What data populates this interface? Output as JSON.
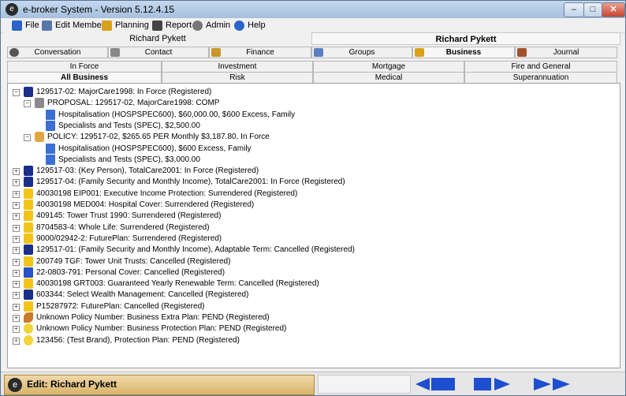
{
  "window": {
    "title": "e-broker System - Version 5.12.4.15",
    "minimize": "–",
    "maximize": "□",
    "close": "✕"
  },
  "menu": [
    {
      "label": "File",
      "icon": "file-icon",
      "color": "#2b64c8"
    },
    {
      "label": "Edit Member",
      "icon": "edit-member-icon",
      "color": "#5577aa"
    },
    {
      "label": "Planning",
      "icon": "planning-icon",
      "color": "#d9a21b"
    },
    {
      "label": "Report",
      "icon": "report-icon",
      "color": "#444444"
    },
    {
      "label": "Admin",
      "icon": "gear-icon",
      "color": "#777777"
    },
    {
      "label": "Help",
      "icon": "help-icon",
      "color": "#2b64c8"
    }
  ],
  "member_headers": {
    "left": "Richard Pykett",
    "right": "Richard Pykett"
  },
  "main_tabs": [
    {
      "label": "Conversation",
      "icon": "conversation-icon",
      "active": false
    },
    {
      "label": "Contact",
      "icon": "contact-icon",
      "active": false
    },
    {
      "label": "Finance",
      "icon": "finance-icon",
      "active": false
    },
    {
      "label": "Groups",
      "icon": "groups-icon",
      "active": false
    },
    {
      "label": "Business",
      "icon": "business-icon",
      "active": true
    },
    {
      "label": "Journal",
      "icon": "journal-icon",
      "active": false
    }
  ],
  "sub_tabs_row1": [
    "In Force",
    "Investment",
    "Mortgage",
    "Fire and General"
  ],
  "sub_tabs_row2": [
    "All Business",
    "Risk",
    "Medical",
    "Superannuation"
  ],
  "tree": [
    {
      "level": 0,
      "expander": "−",
      "icon": "policy-blue",
      "text": "129517-02: MajorCare1998: In Force (Registered)"
    },
    {
      "level": 1,
      "expander": "−",
      "icon": "proposal",
      "text": "PROPOSAL: 129517-02, MajorCare1998: COMP"
    },
    {
      "level": 2,
      "expander": "",
      "icon": "benefit",
      "text": "Hospitalisation (HOSPSPEC600), $60,000.00, $600 Excess, Family"
    },
    {
      "level": 2,
      "expander": "",
      "icon": "benefit",
      "text": "Specialists and Tests (SPEC), $2,500.00"
    },
    {
      "level": 1,
      "expander": "−",
      "icon": "policy-hand",
      "text": "POLICY: 129517-02, $265.65 PER Monthly $3,187.80, In Force"
    },
    {
      "level": 2,
      "expander": "",
      "icon": "benefit",
      "text": "Hospitalisation (HOSPSPEC600), $600 Excess, Family"
    },
    {
      "level": 2,
      "expander": "",
      "icon": "benefit",
      "text": "Specialists and Tests (SPEC), $3,000.00"
    },
    {
      "level": 0,
      "expander": "+",
      "icon": "policy-blue",
      "text": "129517-03: (Key Person), TotalCare2001: In Force (Registered)"
    },
    {
      "level": 0,
      "expander": "+",
      "icon": "policy-blue",
      "text": "129517-04: (Family Security and Monthly Income), TotalCare2001: In Force (Registered)"
    },
    {
      "level": 0,
      "expander": "+",
      "icon": "policy-yellow",
      "text": "40030198 EIP001: Executive Income Protection: Surrendered (Registered)"
    },
    {
      "level": 0,
      "expander": "+",
      "icon": "policy-yellow",
      "text": "40030198 MED004: Hospital Cover: Surrendered (Registered)"
    },
    {
      "level": 0,
      "expander": "+",
      "icon": "policy-yellow",
      "text": "409145: Tower Trust 1990: Surrendered (Registered)"
    },
    {
      "level": 0,
      "expander": "+",
      "icon": "policy-yellow",
      "text": "8704583-4: Whole Life: Surrendered (Registered)"
    },
    {
      "level": 0,
      "expander": "+",
      "icon": "policy-yellow",
      "text": "9000/02942-2: FuturePlan: Surrendered (Registered)"
    },
    {
      "level": 0,
      "expander": "+",
      "icon": "policy-blue",
      "text": "129517-01: (Family Security and Monthly Income), Adaptable Term: Cancelled (Registered)"
    },
    {
      "level": 0,
      "expander": "+",
      "icon": "policy-yellow",
      "text": "200749 TGF: Tower Unit Trusts: Cancelled (Registered)"
    },
    {
      "level": 0,
      "expander": "+",
      "icon": "policy-card",
      "text": "22-0803-791: Personal Cover: Cancelled (Registered)"
    },
    {
      "level": 0,
      "expander": "+",
      "icon": "policy-yellow",
      "text": "40030198 GRT003: Guaranteed Yearly Renewable Term: Cancelled (Registered)"
    },
    {
      "level": 0,
      "expander": "+",
      "icon": "policy-blue",
      "text": "603344: Select Wealth Management: Cancelled (Registered)"
    },
    {
      "level": 0,
      "expander": "+",
      "icon": "policy-yellow",
      "text": "P15287972: FuturePlan: Cancelled (Registered)"
    },
    {
      "level": 0,
      "expander": "+",
      "icon": "policy-swoosh",
      "text": "Unknown Policy Number: Business Extra Plan: PEND (Registered)"
    },
    {
      "level": 0,
      "expander": "+",
      "icon": "policy-circle",
      "text": "Unknown Policy Number: Business Protection Plan: PEND (Registered)"
    },
    {
      "level": 0,
      "expander": "+",
      "icon": "policy-circle",
      "text": "123456: (Test Brand), Protection Plan: PEND (Registered)"
    }
  ],
  "status": {
    "edit_label": "Edit: Richard Pykett"
  },
  "nav_buttons": [
    {
      "name": "nav-first-button",
      "icon": "arrow-left-icon"
    },
    {
      "name": "nav-prev-button",
      "icon": "arrow-left-icon"
    },
    {
      "name": "nav-next-button",
      "icon": "arrow-right-icon"
    },
    {
      "name": "nav-last-button",
      "icon": "arrow-right-icon"
    }
  ],
  "colors": {
    "accent": "#1e4fd1",
    "edit_panel": "#d9b46a"
  }
}
